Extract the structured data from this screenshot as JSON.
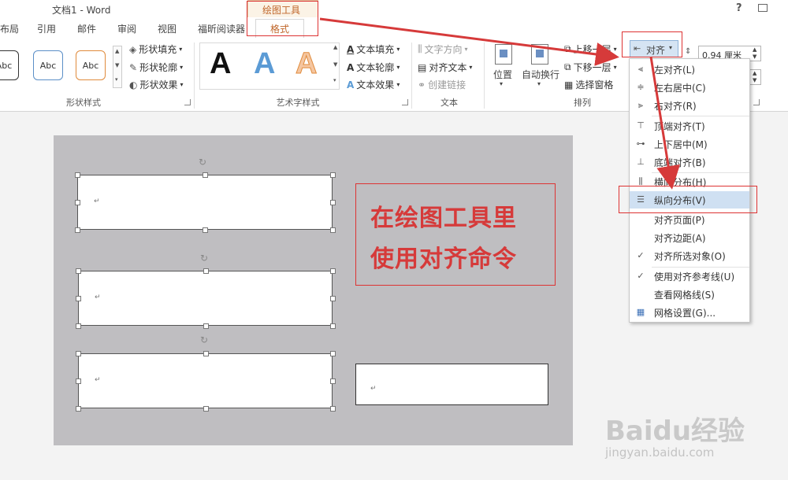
{
  "window": {
    "title": "文档1 - Word",
    "help": "?",
    "restore_icon": "restore-icon"
  },
  "contextual_tab": {
    "group": "绘图工具",
    "tab": "格式"
  },
  "tabs": [
    "布局",
    "引用",
    "邮件",
    "审阅",
    "视图",
    "福昕阅读器"
  ],
  "ribbon": {
    "shape_styles": {
      "label": "形状样式",
      "presets": [
        "Abc",
        "Abc",
        "Abc"
      ],
      "fill": "形状填充",
      "outline": "形状轮廓",
      "effects": "形状效果"
    },
    "wordart": {
      "label": "艺术字样式",
      "samples": [
        "A",
        "A",
        "A"
      ],
      "text_fill": "文本填充",
      "text_outline": "文本轮廓",
      "text_effects": "文本效果"
    },
    "text": {
      "label": "文本",
      "direction": "文字方向",
      "align_text": "对齐文本",
      "create_link": "创建链接"
    },
    "arrange": {
      "label": "排列",
      "position": "位置",
      "wrap": "自动换行",
      "bring_forward": "上移一层",
      "send_backward": "下移一层",
      "selection_pane": "选择窗格",
      "align": "对齐"
    },
    "size": {
      "height": "0.94 厘米"
    }
  },
  "align_menu": {
    "items": [
      {
        "label": "左对齐(L)",
        "icon": "align-left-icon"
      },
      {
        "label": "左右居中(C)",
        "icon": "align-center-icon"
      },
      {
        "label": "右对齐(R)",
        "icon": "align-right-icon"
      },
      {
        "label": "顶端对齐(T)",
        "icon": "align-top-icon"
      },
      {
        "label": "上下居中(M)",
        "icon": "align-middle-icon"
      },
      {
        "label": "底端对齐(B)",
        "icon": "align-bottom-icon"
      },
      {
        "label": "横向分布(H)",
        "icon": "distribute-horizontal-icon"
      },
      {
        "label": "纵向分布(V)",
        "icon": "distribute-vertical-icon"
      },
      {
        "label": "对齐页面(P)",
        "icon": ""
      },
      {
        "label": "对齐边距(A)",
        "icon": ""
      },
      {
        "label": "对齐所选对象(O)",
        "icon": "check-icon"
      },
      {
        "label": "使用对齐参考线(U)",
        "icon": "check-icon"
      },
      {
        "label": "查看网格线(S)",
        "icon": ""
      },
      {
        "label": "网格设置(G)...",
        "icon": "grid-icon"
      }
    ],
    "highlighted_index": 7
  },
  "document": {
    "callout_line1": "在绘图工具里",
    "callout_line2": "使用对齐命令",
    "paragraph_mark": "↵"
  },
  "watermark": {
    "brand": "Baidu经验",
    "url": "jingyan.baidu.com"
  },
  "colors": {
    "accent_red": "#d63a3a",
    "contextual_orange": "#c0662a",
    "menu_highlight": "#cfe0f2",
    "canvas_gray": "#bfbec1"
  }
}
